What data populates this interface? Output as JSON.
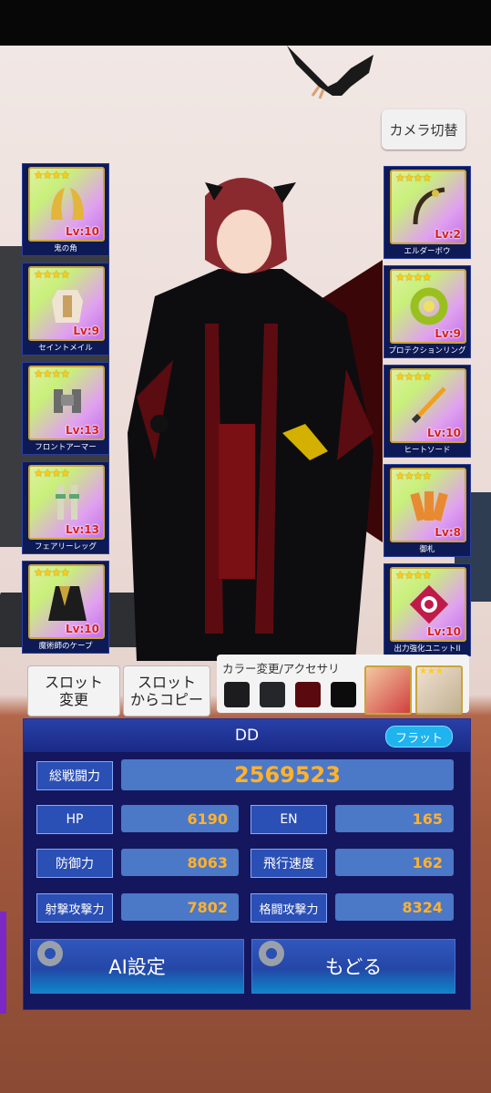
{
  "camera_button": "カメラ切替",
  "left_slots": [
    {
      "name": "鬼の角",
      "level": "Lv:10",
      "stars": "★★★★"
    },
    {
      "name": "セイントメイル",
      "level": "Lv:9",
      "stars": "★★★★"
    },
    {
      "name": "フロントアーマー",
      "level": "Lv:13",
      "stars": "★★★★"
    },
    {
      "name": "フェアリーレッグ",
      "level": "Lv:13",
      "stars": "★★★★"
    },
    {
      "name": "魔術師のケープ",
      "level": "Lv:10",
      "stars": "★★★★"
    }
  ],
  "right_slots": [
    {
      "name": "エルダーボウ",
      "level": "Lv:2",
      "stars": "★★★★"
    },
    {
      "name": "プロテクションリング",
      "level": "Lv:9",
      "stars": "★★★★"
    },
    {
      "name": "ヒートソード",
      "level": "Lv:10",
      "stars": "★★★★"
    },
    {
      "name": "御札",
      "level": "Lv:8",
      "stars": "★★★★"
    },
    {
      "name": "出力強化ユニットII",
      "level": "Lv:10",
      "stars": "★★★★"
    }
  ],
  "slot_change": [
    "スロット",
    "変更"
  ],
  "slot_copy": [
    "スロット",
    "からコピー"
  ],
  "accessory": {
    "label": "カラー変更/アクセサリ",
    "colors": [
      "#1c1c1e",
      "#242629",
      "#5a0a0e",
      "#0c0c0c"
    ],
    "star_text": "★★★"
  },
  "panel": {
    "title": "DD",
    "mode_badge": "フラット",
    "total_label": "総戦闘力",
    "total_value": "2569523",
    "stats": [
      {
        "label": "HP",
        "value": "6190"
      },
      {
        "label": "EN",
        "value": "165"
      },
      {
        "label": "防御力",
        "value": "8063"
      },
      {
        "label": "飛行速度",
        "value": "162"
      },
      {
        "label": "射撃攻撃力",
        "value": "7802"
      },
      {
        "label": "格闘攻撃力",
        "value": "8324"
      }
    ],
    "ai_button": "AI設定",
    "back_button": "もどる"
  },
  "colors": {
    "accent": "#ffb22c",
    "panel": "#14175e",
    "badge": "#1fb3f0"
  }
}
